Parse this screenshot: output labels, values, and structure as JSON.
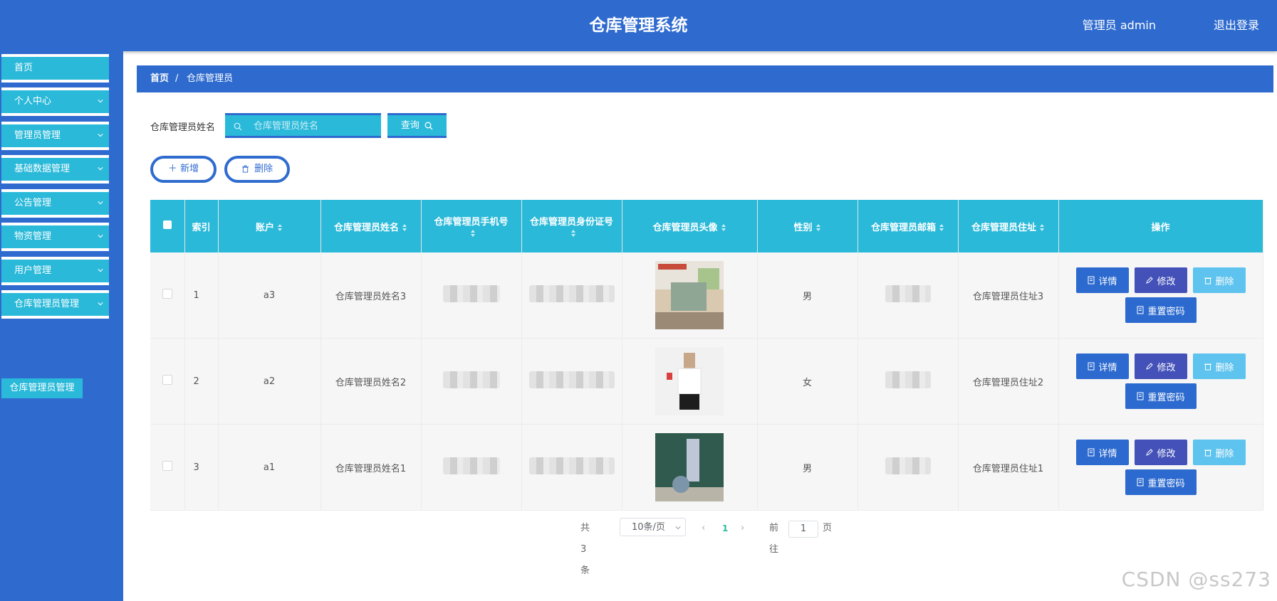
{
  "app": {
    "title": "仓库管理系统",
    "user_info": "管理员 admin",
    "logout": "退出登录"
  },
  "sidebar": {
    "items": [
      {
        "label": "首页",
        "has_submenu": false
      },
      {
        "label": "个人中心",
        "has_submenu": true
      },
      {
        "label": "管理员管理",
        "has_submenu": true
      },
      {
        "label": "基础数据管理",
        "has_submenu": true
      },
      {
        "label": "公告管理",
        "has_submenu": true
      },
      {
        "label": "物资管理",
        "has_submenu": true
      },
      {
        "label": "用户管理",
        "has_submenu": true
      },
      {
        "label": "仓库管理员管理",
        "has_submenu": true
      }
    ],
    "active_subitem": "仓库管理员管理"
  },
  "breadcrumb": {
    "home": "首页",
    "separator": "/",
    "current": "仓库管理员"
  },
  "search": {
    "label": "仓库管理员姓名",
    "placeholder": "仓库管理员姓名",
    "value": "",
    "button": "查询"
  },
  "toolbar": {
    "add": "新增",
    "delete": "删除"
  },
  "table": {
    "columns": [
      "索引",
      "账户",
      "仓库管理员姓名",
      "仓库管理员手机号",
      "仓库管理员身份证号",
      "仓库管理员头像",
      "性别",
      "仓库管理员邮箱",
      "仓库管理员住址",
      "操作"
    ],
    "rows": [
      {
        "index": "1",
        "account": "a3",
        "name": "仓库管理员姓名3",
        "gender": "男",
        "address": "仓库管理员住址3",
        "avatar": "classroom-photo"
      },
      {
        "index": "2",
        "account": "a2",
        "name": "仓库管理员姓名2",
        "gender": "女",
        "address": "仓库管理员住址2",
        "avatar": "person-photo"
      },
      {
        "index": "3",
        "account": "a1",
        "name": "仓库管理员姓名1",
        "gender": "男",
        "address": "仓库管理员住址1",
        "avatar": "blackboard-photo"
      }
    ],
    "actions": {
      "detail": "详情",
      "edit": "修改",
      "delete": "删除",
      "reset": "重置密码"
    }
  },
  "pagination": {
    "total": "共 3 条",
    "page_size": "10条/页",
    "current": "1",
    "goto_label": "前往",
    "goto_value": "1",
    "page_unit": "页"
  },
  "watermark": "CSDN @ss273",
  "colors": {
    "primary": "#2f6bcf",
    "cyan": "#2ab9d9",
    "edit": "#4351b8",
    "delete": "#5ec3ee"
  }
}
